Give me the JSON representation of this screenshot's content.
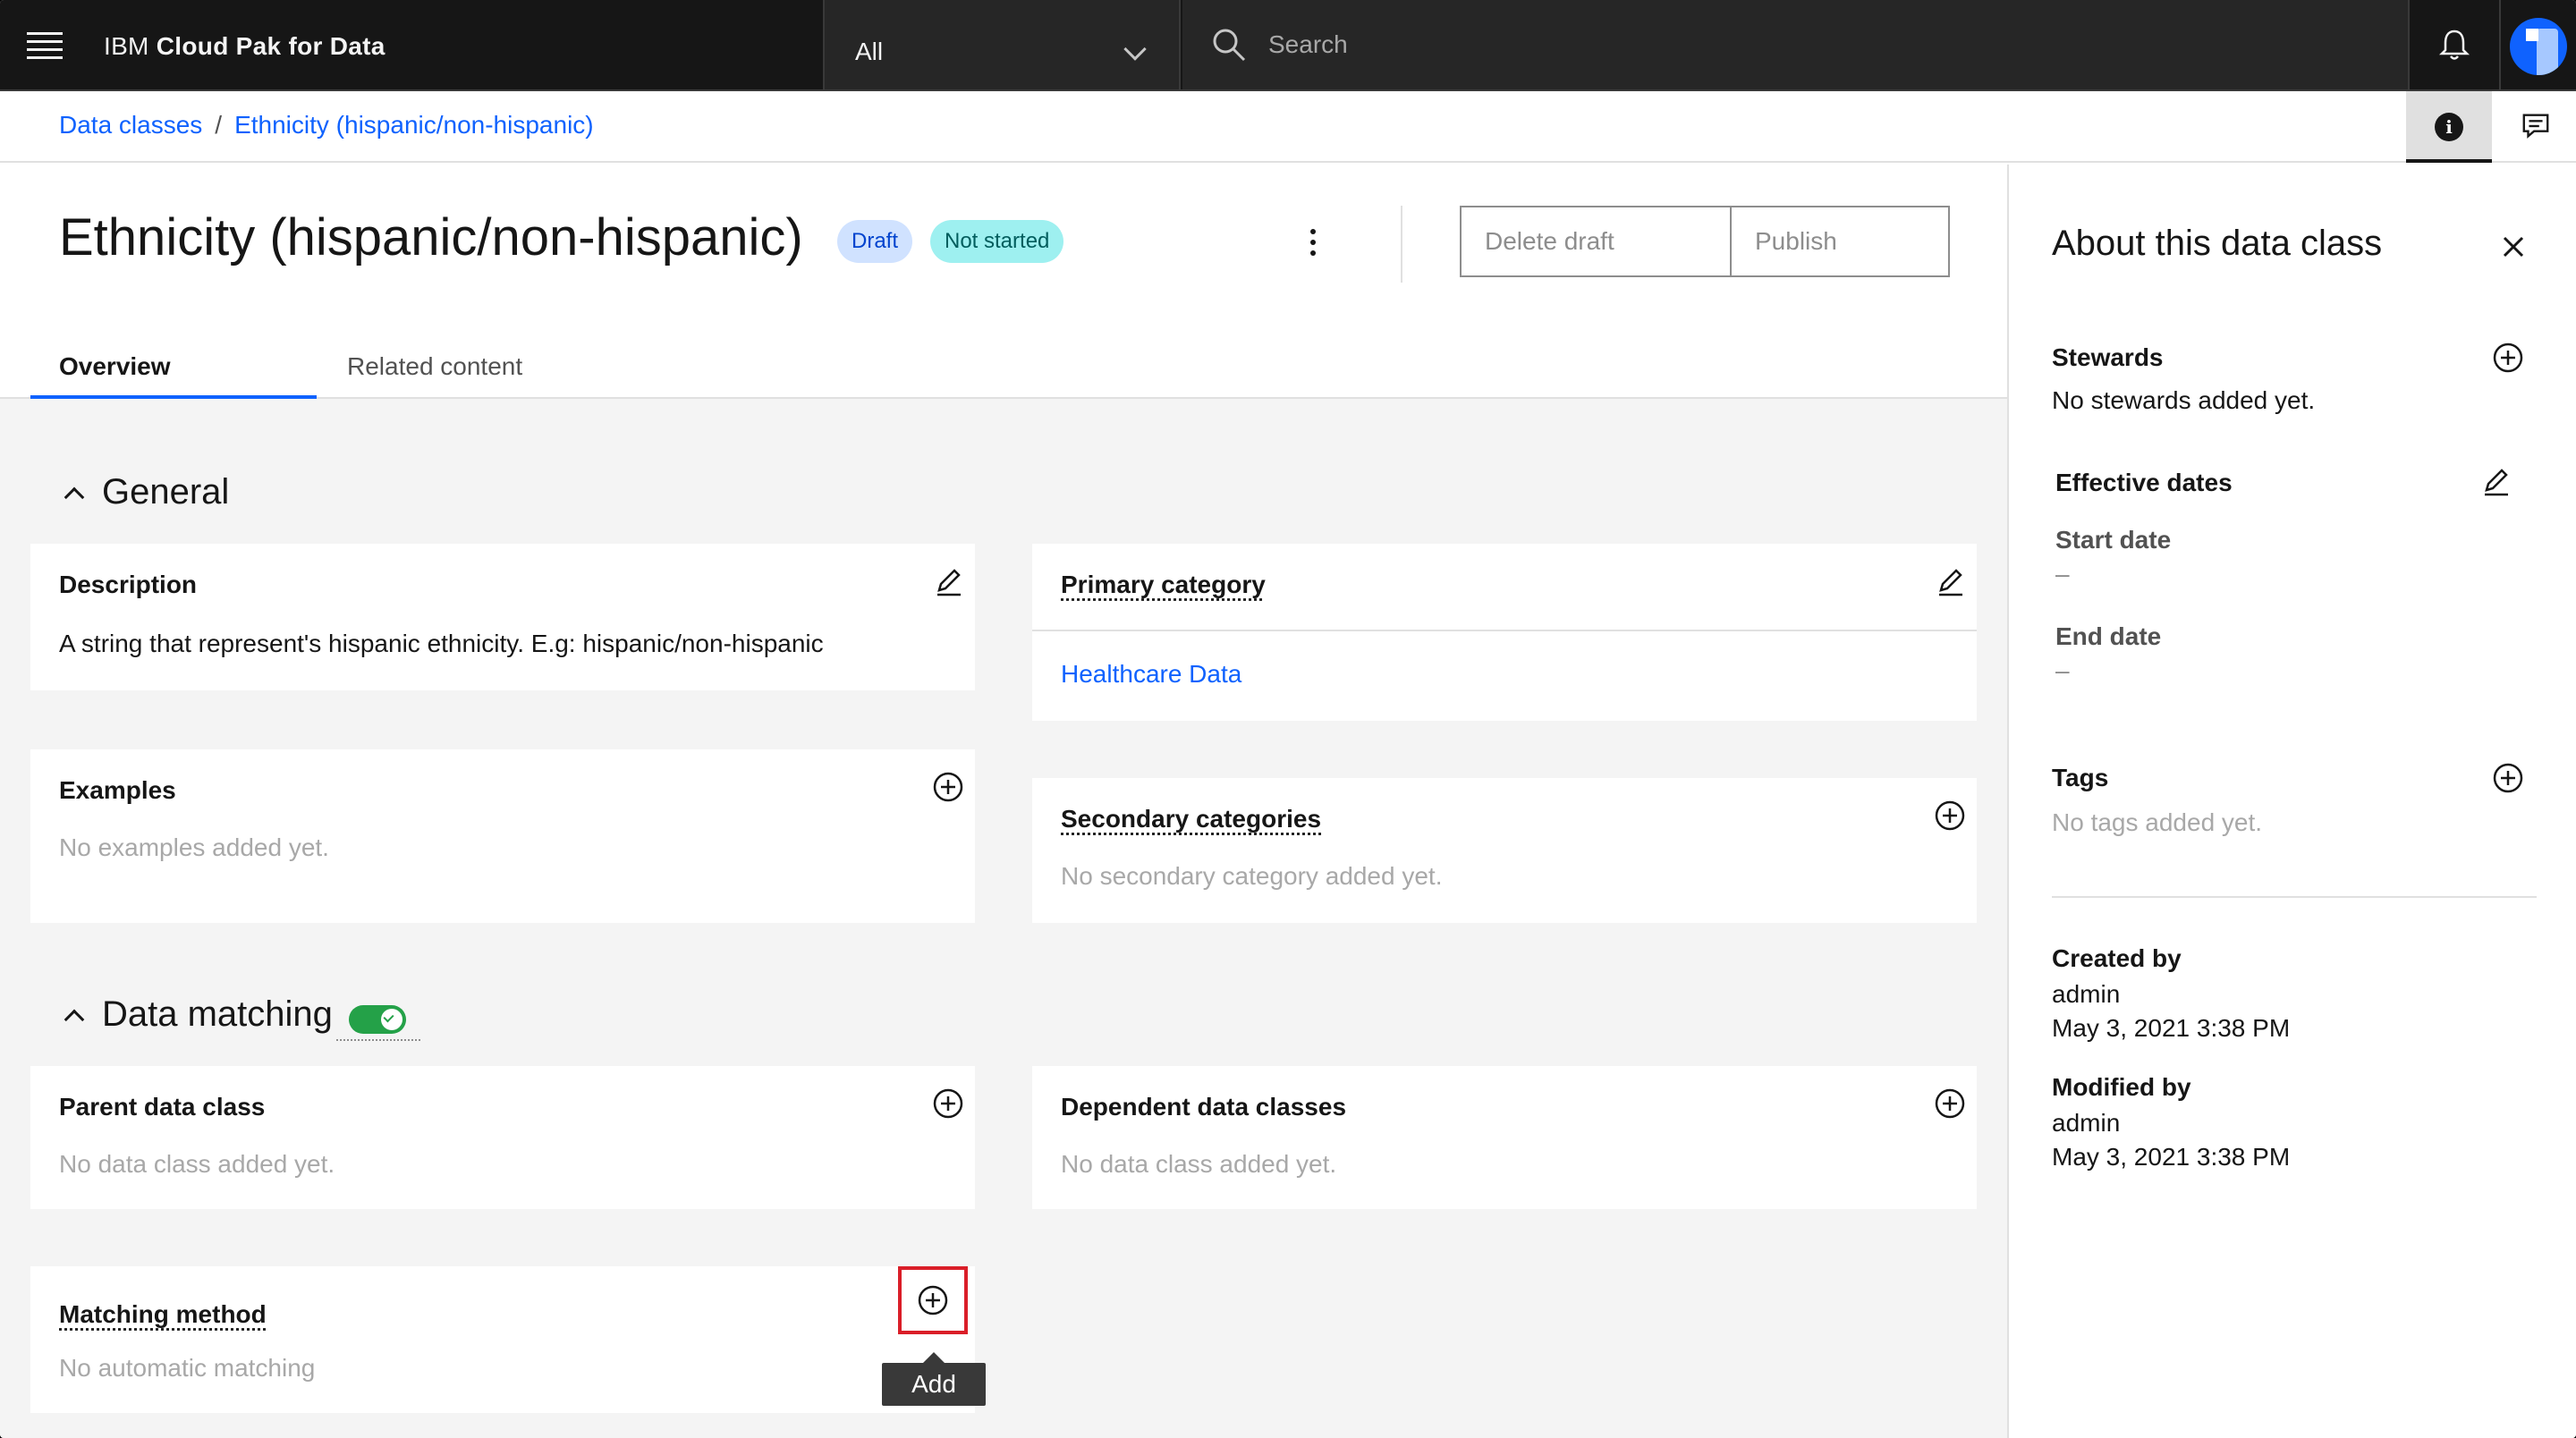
{
  "header": {
    "brand_prefix": "IBM",
    "brand_name": "Cloud Pak for Data",
    "scope_label": "All",
    "search_placeholder": "Search"
  },
  "breadcrumb": {
    "items": [
      "Data classes",
      "Ethnicity (hispanic/non-hispanic)"
    ],
    "separator": "/"
  },
  "page": {
    "title": "Ethnicity (hispanic/non-hispanic)",
    "tags": [
      "Draft",
      "Not started"
    ],
    "delete_label": "Delete draft",
    "publish_label": "Publish",
    "tabs": [
      "Overview",
      "Related content"
    ]
  },
  "general": {
    "title": "General",
    "description": {
      "heading": "Description",
      "value": "A string that represent's hispanic ethnicity. E.g: hispanic/non-hispanic"
    },
    "primary_category": {
      "heading": "Primary category",
      "value": "Healthcare Data"
    },
    "examples": {
      "heading": "Examples",
      "value": "No examples added yet."
    },
    "secondary_categories": {
      "heading": "Secondary categories",
      "value": "No secondary category added yet."
    }
  },
  "data_matching": {
    "title": "Data matching",
    "enabled": true,
    "parent": {
      "heading": "Parent data class",
      "value": "No data class added yet."
    },
    "dependent": {
      "heading": "Dependent data classes",
      "value": "No data class added yet."
    },
    "matching_method": {
      "heading": "Matching method",
      "value": "No automatic matching"
    },
    "tooltip": "Add"
  },
  "panel": {
    "title": "About this data class",
    "stewards_label": "Stewards",
    "stewards_value": "No stewards added yet.",
    "effective_dates_label": "Effective dates",
    "start_date_label": "Start date",
    "start_date_value": "–",
    "end_date_label": "End date",
    "end_date_value": "–",
    "tags_label": "Tags",
    "tags_value": "No tags added yet.",
    "created_by_label": "Created by",
    "created_by_user": "admin",
    "created_by_date": "May 3, 2021 3:38 PM",
    "modified_by_label": "Modified by",
    "modified_by_user": "admin",
    "modified_by_date": "May 3, 2021 3:38 PM"
  },
  "colors": {
    "accent": "#0f62fe",
    "toggle_on": "#24a148",
    "focus": "#da1e28"
  }
}
